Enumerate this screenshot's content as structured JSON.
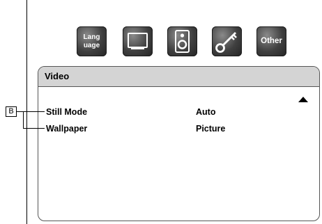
{
  "icons": {
    "language": {
      "line1": "Lang",
      "line2": "uage"
    },
    "display": "display-icon",
    "audio": "speaker-icon",
    "parental": "key-icon",
    "other": "Other"
  },
  "panel": {
    "title": "Video"
  },
  "callout": "B",
  "settings": [
    {
      "label": "Still Mode",
      "value": "Auto"
    },
    {
      "label": "Wallpaper",
      "value": "Picture"
    }
  ]
}
